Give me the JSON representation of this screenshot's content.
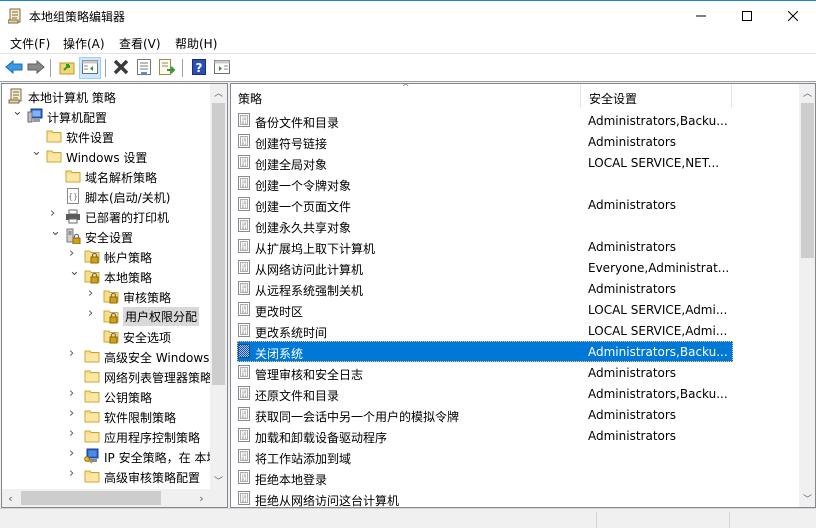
{
  "window": {
    "title": "本地组策略编辑器",
    "controls": {
      "minimize": "—",
      "maximize": "☐",
      "close": "✕"
    }
  },
  "menubar": {
    "items": [
      {
        "label": "文件(F)"
      },
      {
        "label": "操作(A)"
      },
      {
        "label": "查看(V)"
      },
      {
        "label": "帮助(H)"
      }
    ]
  },
  "toolbar": {
    "buttons": [
      {
        "name": "back",
        "icon": "arrow-left-icon"
      },
      {
        "name": "forward",
        "icon": "arrow-right-icon"
      },
      {
        "name": "up-one-level",
        "icon": "folder-up-icon"
      },
      {
        "name": "show-hide-console-tree",
        "icon": "console-tree-icon",
        "active": true
      },
      {
        "name": "delete",
        "icon": "delete-x-icon"
      },
      {
        "name": "properties",
        "icon": "properties-icon"
      },
      {
        "name": "export-list",
        "icon": "export-list-icon"
      },
      {
        "name": "help",
        "icon": "help-icon"
      },
      {
        "name": "show-hide-action-pane",
        "icon": "action-pane-icon"
      }
    ]
  },
  "tree": {
    "items": [
      {
        "label": "本地计算机 策略",
        "level": 0,
        "expander": "none",
        "icon": "policy-scroll-icon"
      },
      {
        "label": "计算机配置",
        "level": 1,
        "expander": "expanded",
        "icon": "computer-icon"
      },
      {
        "label": "软件设置",
        "level": 2,
        "expander": "none",
        "icon": "folder-icon"
      },
      {
        "label": "Windows 设置",
        "level": 2,
        "expander": "expanded",
        "icon": "folder-icon"
      },
      {
        "label": "域名解析策略",
        "level": 3,
        "expander": "none",
        "icon": "folder-icon"
      },
      {
        "label": "脚本(启动/关机)",
        "level": 3,
        "expander": "none",
        "icon": "script-icon"
      },
      {
        "label": "已部署的打印机",
        "level": 3,
        "expander": "collapsed",
        "icon": "printer-icon"
      },
      {
        "label": "安全设置",
        "level": 3,
        "expander": "expanded",
        "icon": "security-settings-icon"
      },
      {
        "label": "帐户策略",
        "level": 4,
        "expander": "collapsed",
        "icon": "locked-folder-icon"
      },
      {
        "label": "本地策略",
        "level": 4,
        "expander": "expanded",
        "icon": "locked-folder-icon"
      },
      {
        "label": "审核策略",
        "level": 5,
        "expander": "collapsed",
        "icon": "locked-folder-icon"
      },
      {
        "label": "用户权限分配",
        "level": 5,
        "expander": "collapsed",
        "icon": "locked-folder-icon",
        "selected": true
      },
      {
        "label": "安全选项",
        "level": 5,
        "expander": "none",
        "icon": "locked-folder-icon"
      },
      {
        "label": "高级安全 Windows",
        "level": 4,
        "expander": "collapsed",
        "icon": "folder-icon"
      },
      {
        "label": "网络列表管理器策略",
        "level": 4,
        "expander": "none",
        "icon": "folder-icon"
      },
      {
        "label": "公钥策略",
        "level": 4,
        "expander": "collapsed",
        "icon": "folder-icon"
      },
      {
        "label": "软件限制策略",
        "level": 4,
        "expander": "collapsed",
        "icon": "folder-icon"
      },
      {
        "label": "应用程序控制策略",
        "level": 4,
        "expander": "collapsed",
        "icon": "folder-icon"
      },
      {
        "label": "IP 安全策略，在 本地",
        "level": 4,
        "expander": "collapsed",
        "icon": "ip-security-icon"
      },
      {
        "label": "高级审核策略配置",
        "level": 4,
        "expander": "collapsed",
        "icon": "folder-icon"
      }
    ],
    "vscroll": {
      "position": 0.0,
      "visible_fraction": 0.72
    },
    "hscroll": {
      "position": 0.0,
      "visible_fraction": 0.71
    }
  },
  "list": {
    "columns": [
      {
        "label": "策略",
        "sorted": "ascending"
      },
      {
        "label": "安全设置"
      }
    ],
    "rows": [
      {
        "name": "备份文件和目录",
        "setting": "Administrators,Backu..."
      },
      {
        "name": "创建符号链接",
        "setting": "Administrators"
      },
      {
        "name": "创建全局对象",
        "setting": "LOCAL SERVICE,NET..."
      },
      {
        "name": "创建一个令牌对象",
        "setting": ""
      },
      {
        "name": "创建一个页面文件",
        "setting": "Administrators"
      },
      {
        "name": "创建永久共享对象",
        "setting": ""
      },
      {
        "name": "从扩展坞上取下计算机",
        "setting": "Administrators"
      },
      {
        "name": "从网络访问此计算机",
        "setting": "Everyone,Administrat..."
      },
      {
        "name": "从远程系统强制关机",
        "setting": "Administrators"
      },
      {
        "name": "更改时区",
        "setting": "LOCAL SERVICE,Admi..."
      },
      {
        "name": "更改系统时间",
        "setting": "LOCAL SERVICE,Admi..."
      },
      {
        "name": "关闭系统",
        "setting": "Administrators,Backu...",
        "selected": true
      },
      {
        "name": "管理审核和安全日志",
        "setting": "Administrators"
      },
      {
        "name": "还原文件和目录",
        "setting": "Administrators,Backu..."
      },
      {
        "name": "获取同一会话中另一个用户的模拟令牌",
        "setting": "Administrators"
      },
      {
        "name": "加载和卸载设备驱动程序",
        "setting": "Administrators"
      },
      {
        "name": "将工作站添加到域",
        "setting": ""
      },
      {
        "name": "拒绝本地登录",
        "setting": ""
      },
      {
        "name": "拒绝从网络访问这台计算机",
        "setting": ""
      }
    ],
    "vscroll": {
      "position": 0.0,
      "visible_fraction": 0.4
    }
  },
  "colors": {
    "selection": "#0078d7",
    "tree_selection": "#d9d9d9",
    "title_accent": "#1883d7"
  }
}
